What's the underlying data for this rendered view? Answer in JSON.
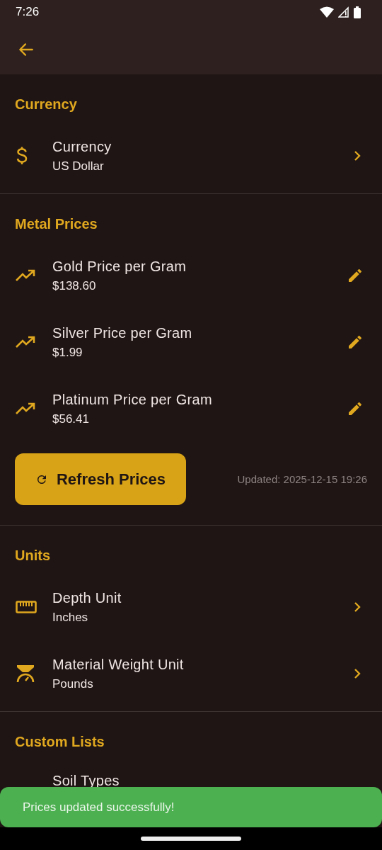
{
  "status_bar": {
    "time": "7:26"
  },
  "sections": [
    {
      "header": "Currency",
      "items": [
        {
          "kind": "nav",
          "title": "Currency",
          "subtitle": "US Dollar"
        }
      ]
    },
    {
      "header": "Metal Prices",
      "items": [
        {
          "kind": "edit",
          "title": "Gold Price per Gram",
          "subtitle": "$138.60"
        },
        {
          "kind": "edit",
          "title": "Silver Price per Gram",
          "subtitle": "$1.99"
        },
        {
          "kind": "edit",
          "title": "Platinum Price per Gram",
          "subtitle": "$56.41"
        }
      ],
      "refresh": {
        "label": "Refresh Prices",
        "updated": "Updated: 2025-12-15 19:26"
      }
    },
    {
      "header": "Units",
      "items": [
        {
          "kind": "nav",
          "title": "Depth Unit",
          "subtitle": "Inches"
        },
        {
          "kind": "nav",
          "title": "Material Weight Unit",
          "subtitle": "Pounds"
        }
      ]
    },
    {
      "header": "Custom Lists",
      "items": [
        {
          "kind": "partial",
          "title": "Soil Types"
        }
      ]
    }
  ],
  "snackbar": {
    "message": "Prices updated successfully!"
  }
}
